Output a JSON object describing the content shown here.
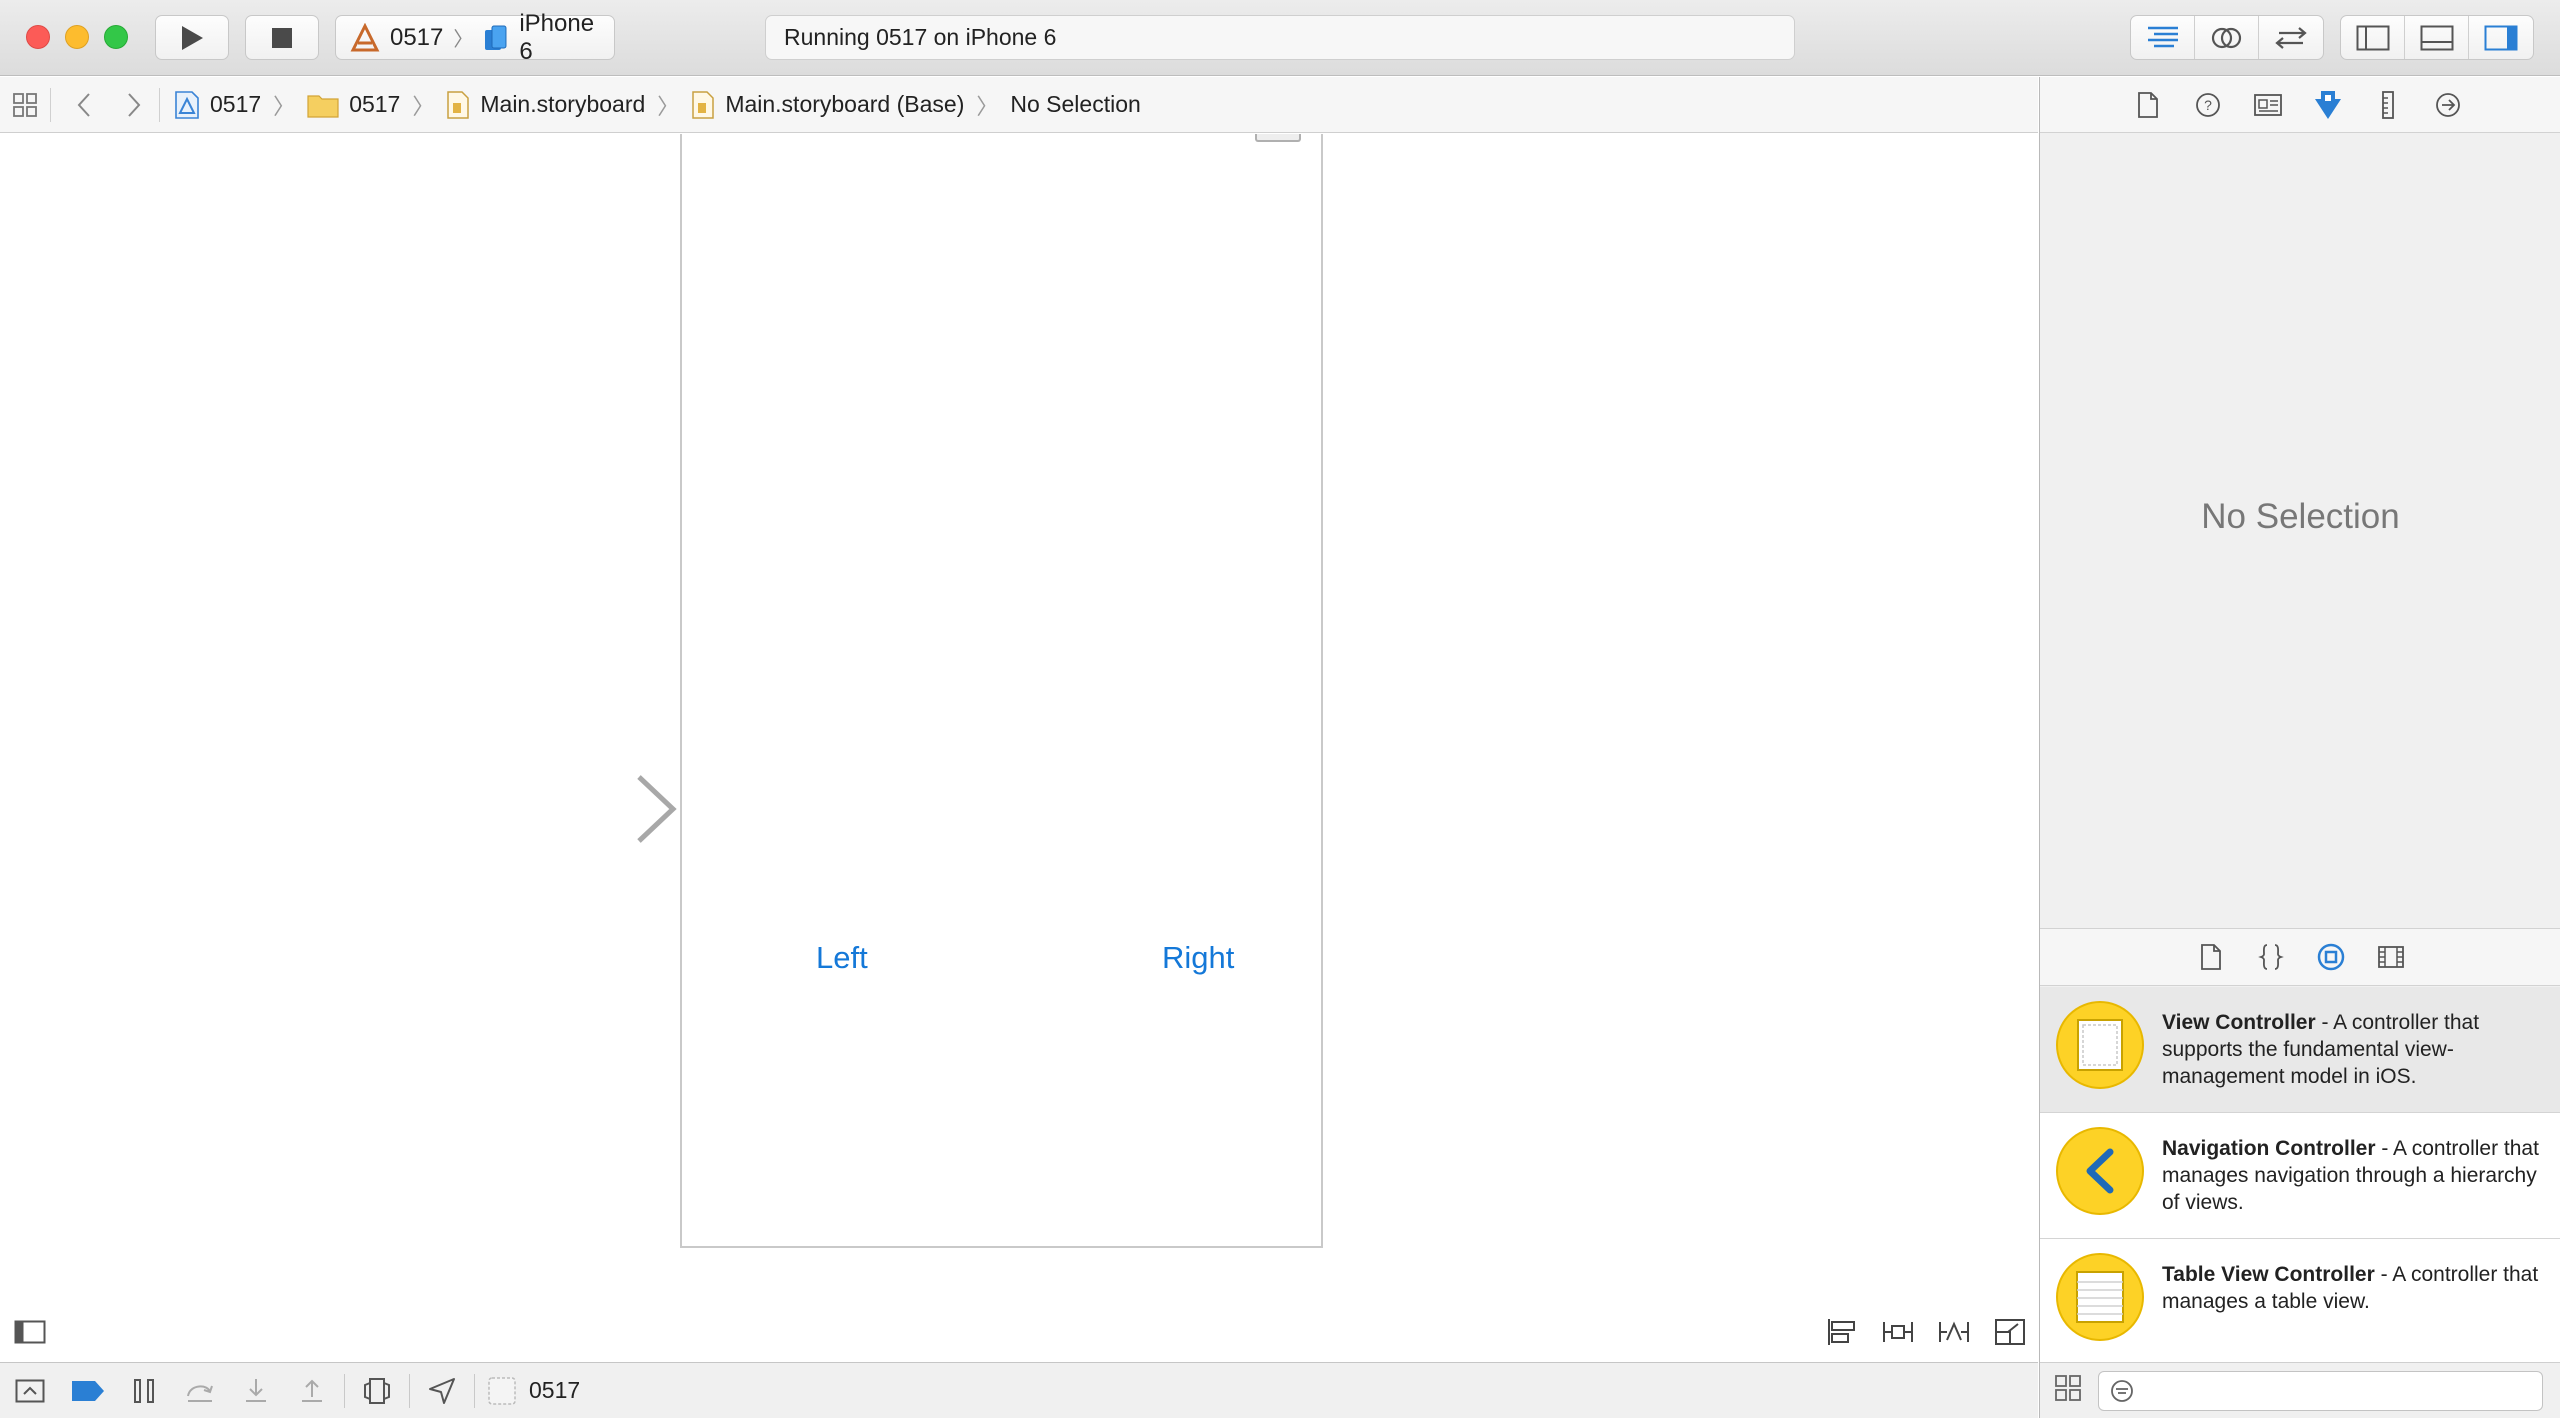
{
  "toolbar": {
    "scheme_target": "0517",
    "scheme_device": "iPhone 6",
    "activity_text": "Running 0517 on iPhone 6"
  },
  "jumpbar": {
    "crumbs": [
      "0517",
      "0517",
      "Main.storyboard",
      "Main.storyboard (Base)",
      "No Selection"
    ]
  },
  "canvas": {
    "button_left": "Left",
    "button_right": "Right"
  },
  "debugbar": {
    "process_name": "0517"
  },
  "inspector": {
    "empty_text": "No Selection"
  },
  "library": {
    "items": [
      {
        "title": "View Controller",
        "description": " - A controller that supports the fundamental view-management model in iOS."
      },
      {
        "title": "Navigation Controller",
        "description": " - A controller that manages navigation through a hierarchy of views."
      },
      {
        "title": "Table View Controller",
        "description": " - A controller that manages a table view."
      }
    ],
    "filter_placeholder": ""
  },
  "colors": {
    "accent": "#1478d8",
    "library_icon": "#fdd226",
    "traffic_close": "#fc5b57",
    "traffic_min": "#fdbc2e",
    "traffic_max": "#33c748"
  }
}
